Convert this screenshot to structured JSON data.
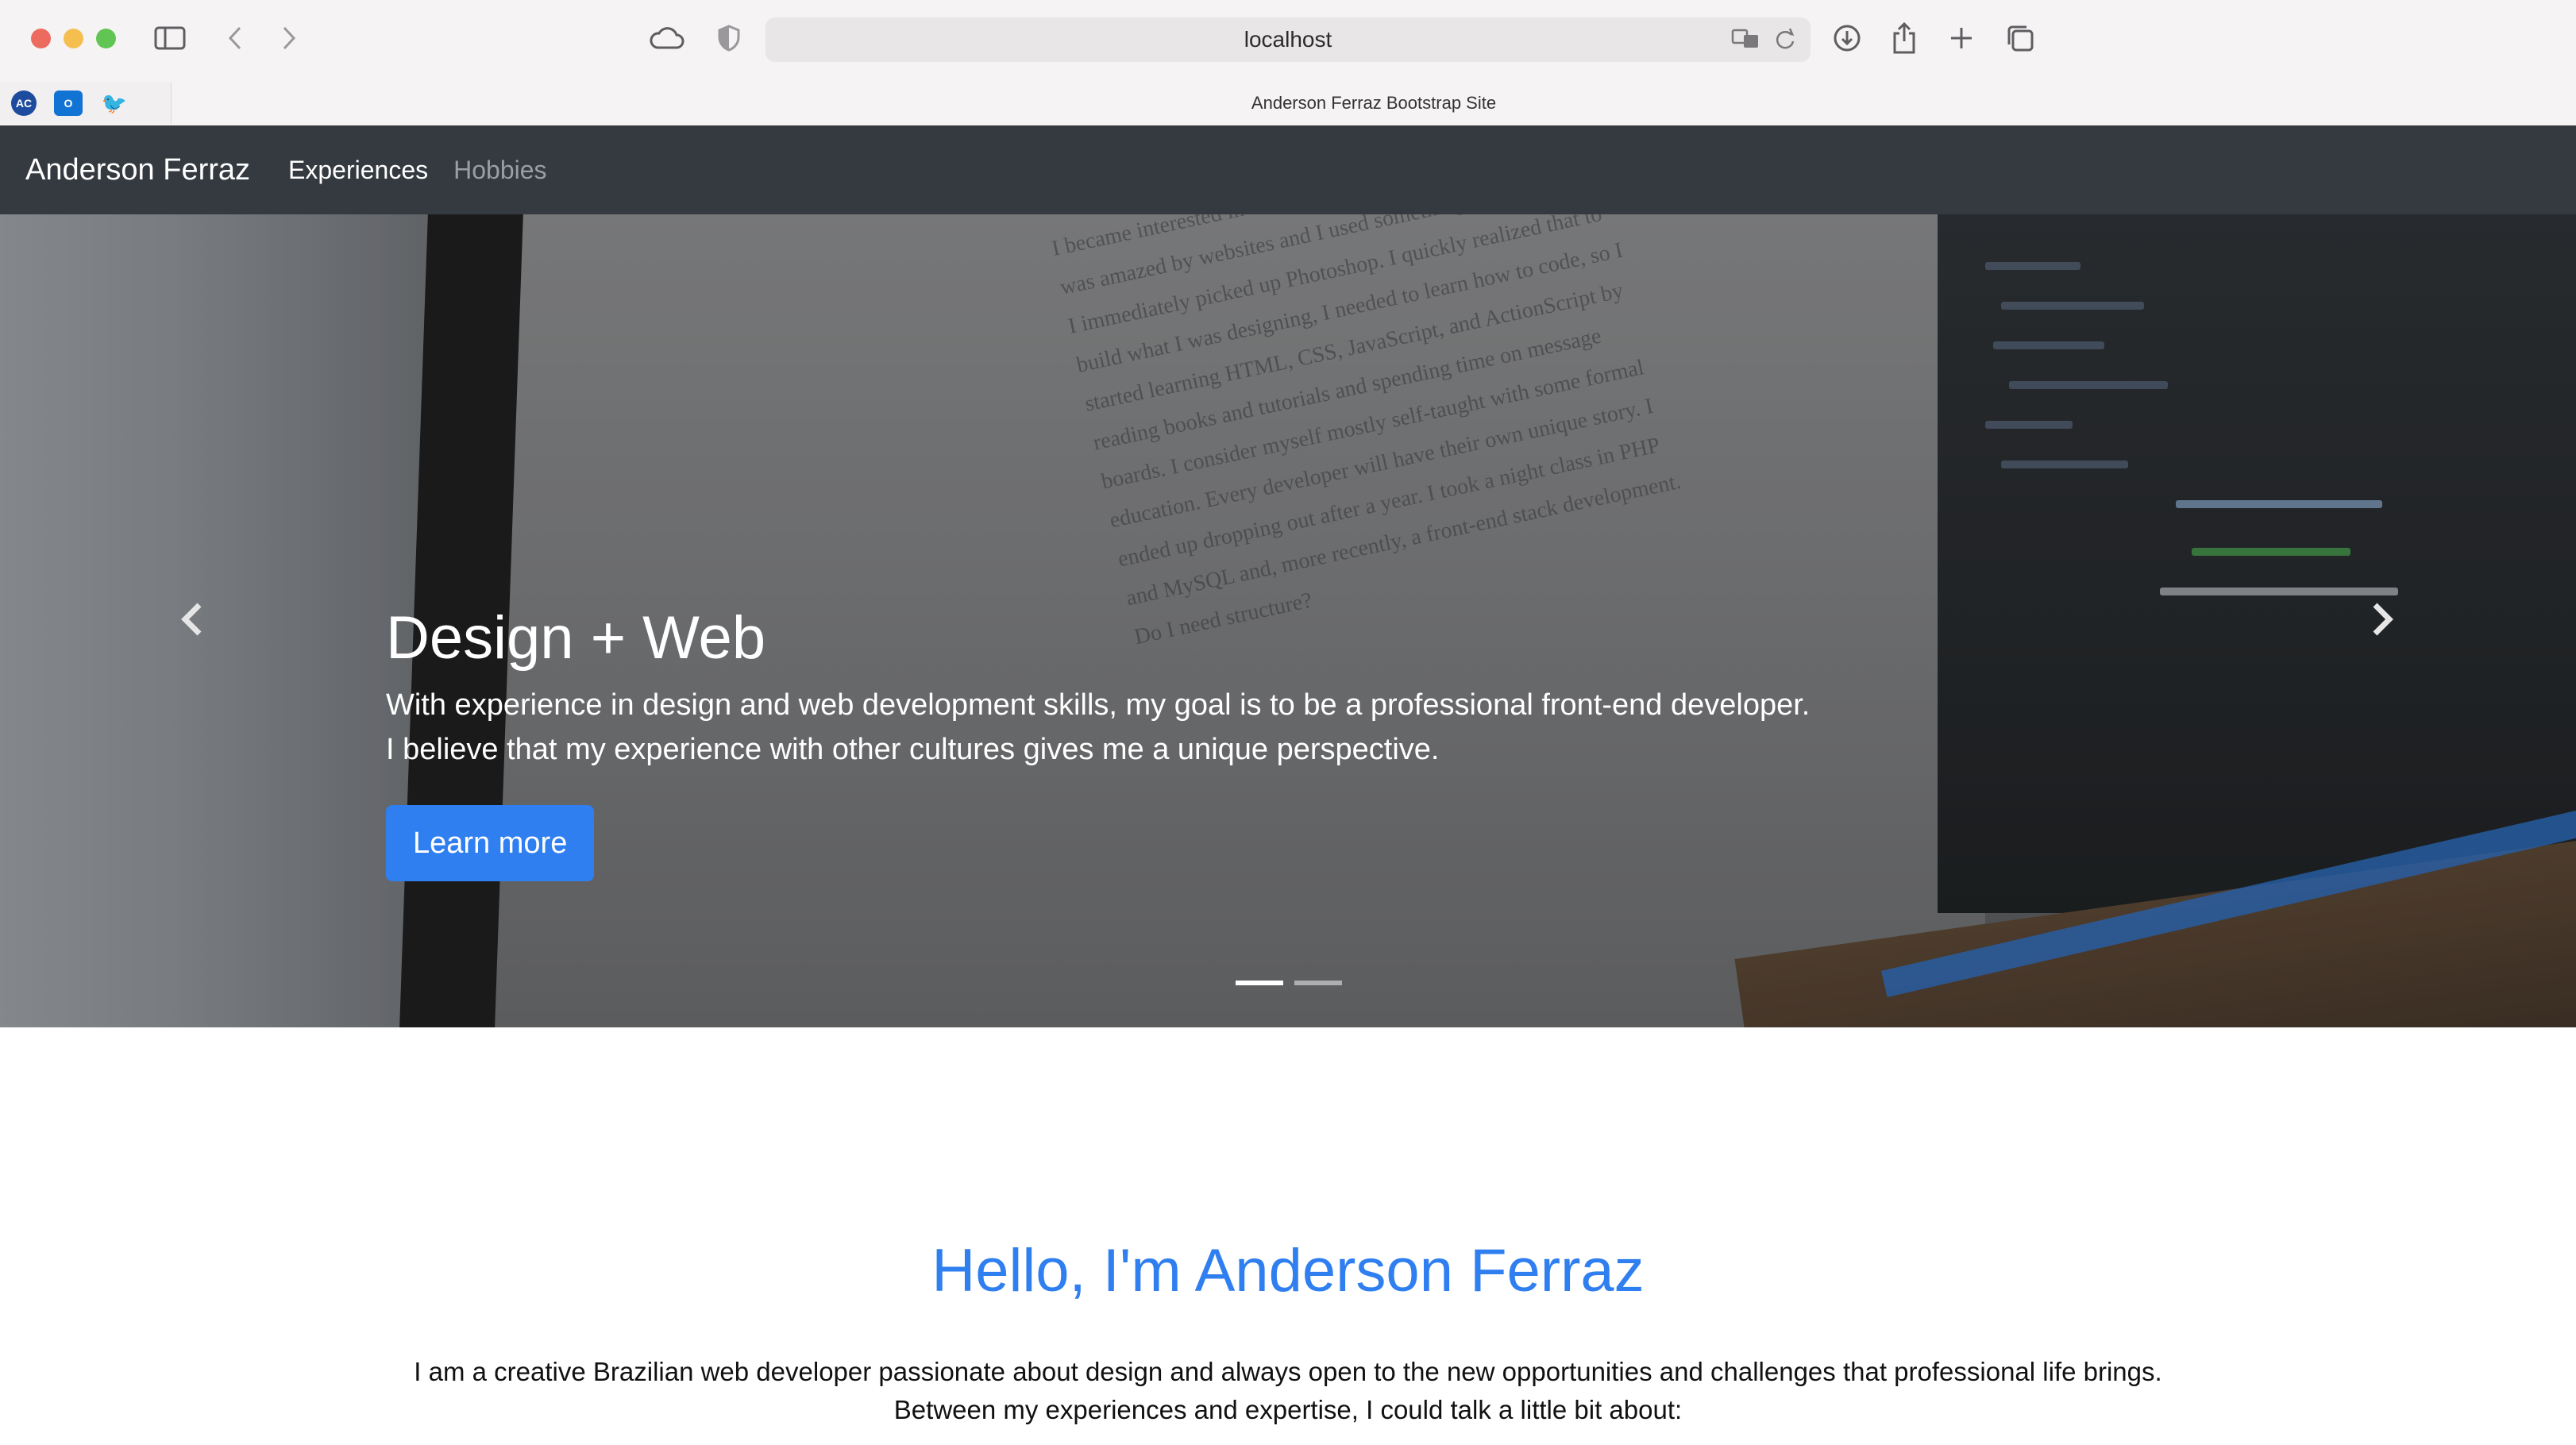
{
  "browser": {
    "url": "localhost",
    "tab_title": "Anderson Ferraz Bootstrap Site",
    "favorites": [
      {
        "icon": "ac-favicon",
        "label": "AC"
      },
      {
        "icon": "outlook-favicon",
        "label": "O"
      },
      {
        "icon": "cardinal-favicon",
        "label": "🐦"
      }
    ]
  },
  "navbar": {
    "brand": "Anderson Ferraz",
    "links": [
      {
        "label": "Experiences",
        "active": true
      },
      {
        "label": "Hobbies",
        "active": false
      }
    ]
  },
  "carousel": {
    "slide": {
      "title": "Design + Web",
      "text_line1": "With experience in design and web development skills, my goal is to be a professional front-end developer.",
      "text_line2": "I believe that my experience with other cultures gives me a unique perspective.",
      "button": "Learn more"
    },
    "indicators": 2,
    "active_indicator": 0,
    "background_text": "I became interested in design when I got my first computer. I was amazed by websites and I used something called Flash, and I immediately picked up Photoshop. I quickly realized that to build what I was designing, I needed to learn how to code, so I started learning HTML, CSS, JavaScript, and ActionScript by reading books and tutorials and spending time on message boards. I consider myself mostly self-taught with some formal education. Every developer will have their own unique story. I ended up dropping out after a year. I took a night class in PHP and MySQL and, more recently, a front-end stack development. Do I need structure?"
  },
  "content": {
    "heading": "Hello, I'm Anderson Ferraz",
    "intro_line1": "I am a creative Brazilian web developer passionate about design and always open to the new opportunities and challenges that professional life brings.",
    "intro_line2": "Between my experiences and expertise, I could talk a little bit about:"
  },
  "colors": {
    "primary": "#2f7ff0",
    "navbar_bg": "#343a40"
  }
}
